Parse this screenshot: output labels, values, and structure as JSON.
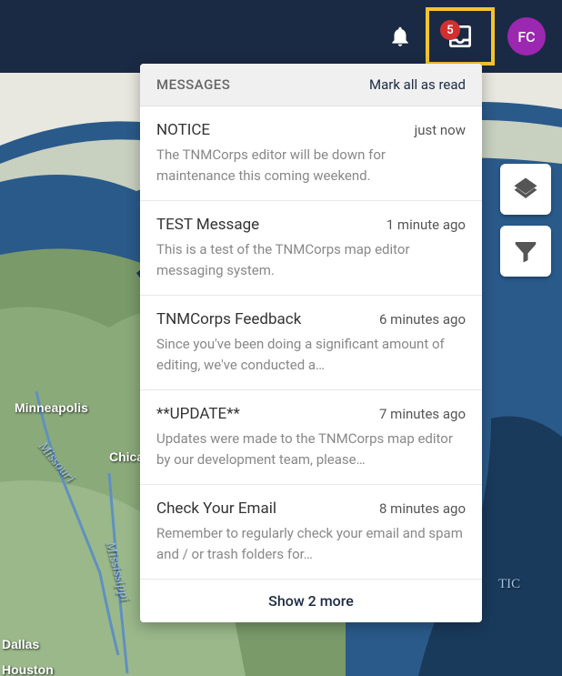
{
  "header": {
    "badge_count": "5",
    "avatar_initials": "FC"
  },
  "messages_panel": {
    "title": "MESSAGES",
    "mark_all": "Mark all as read",
    "footer": "Show 2 more",
    "items": [
      {
        "title": "NOTICE",
        "time": "just now",
        "body": "The TNMCorps editor will be down for maintenance this coming weekend."
      },
      {
        "title": "TEST Message",
        "time": "1 minute ago",
        "body": "This is a test of the TNMCorps map editor messaging system."
      },
      {
        "title": "TNMCorps Feedback",
        "time": "6 minutes ago",
        "body": "Since you've been doing a significant amount of editing, we've conducted a…"
      },
      {
        "title": "**UPDATE**",
        "time": "7 minutes ago",
        "body": "Updates were made to the TNMCorps map editor by our development team, please…"
      },
      {
        "title": "Check Your Email",
        "time": "8 minutes ago",
        "body": "Remember to regularly check your email and spam and / or trash folders for…"
      }
    ]
  },
  "map_labels": {
    "minneapolis": "Minneapolis",
    "chicago": "Chica",
    "dallas": "Dallas",
    "houston": "Houston",
    "missouri": "Missouri",
    "mississippi": "Mississippi",
    "atlantic": "TIC"
  }
}
